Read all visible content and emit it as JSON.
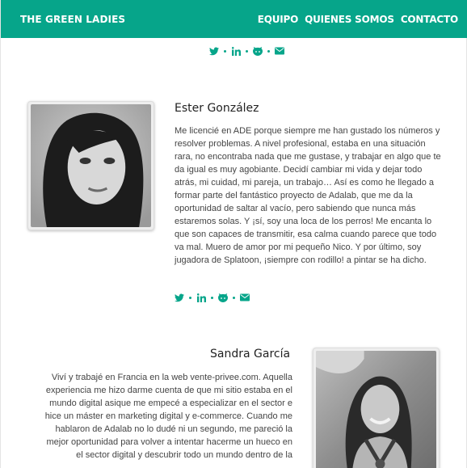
{
  "header": {
    "brand": "THE GREEN LADIES",
    "menu": [
      "EQUIPO",
      "QUIENES SOMOS",
      "CONTACTO"
    ]
  },
  "social_icons": [
    "twitter-icon",
    "linkedin-icon",
    "github-icon",
    "email-icon"
  ],
  "accent_color": "#06a58a",
  "members": [
    {
      "name": "Ester González",
      "bio": "Me licencié en ADE porque siempre me han gustado los números y resolver problemas. A nivel profesional, estaba en una situación rara, no encontraba nada que me gustase, y trabajar en algo que te da igual es muy agobiante. Decidí cambiar mi vida y dejar todo atrás, mi cuidad, mi pareja, un trabajo… Así es como he llegado a formar parte del fantástico proyecto de Adalab, que me da la oportunidad de saltar al vacío, pero sabiendo que nunca más estaremos solas. Y ¡sí, soy una loca de los perros! Me encanta lo que son capaces de transmitir, esa calma cuando parece que todo va mal. Muero de amor por mi pequeño Nico. Y por último, soy jugadora de Splatoon, ¡siempre con rodillo! a pintar se ha dicho."
    },
    {
      "name": "Sandra García",
      "bio": "Viví y trabajé en Francia en la web vente-privee.com. Aquella experiencia me hizo darme cuenta de que mi sitio estaba en el mundo digital asique me empecé a especializar en el sector e hice un máster en marketing digital y e-commerce. Cuando me hablaron de Adalab no lo dudé ni un segundo, me pareció la mejor oportunidad para volver a intentar hacerme un hueco en el sector digital y descubrir todo un mundo dentro de la"
    }
  ]
}
